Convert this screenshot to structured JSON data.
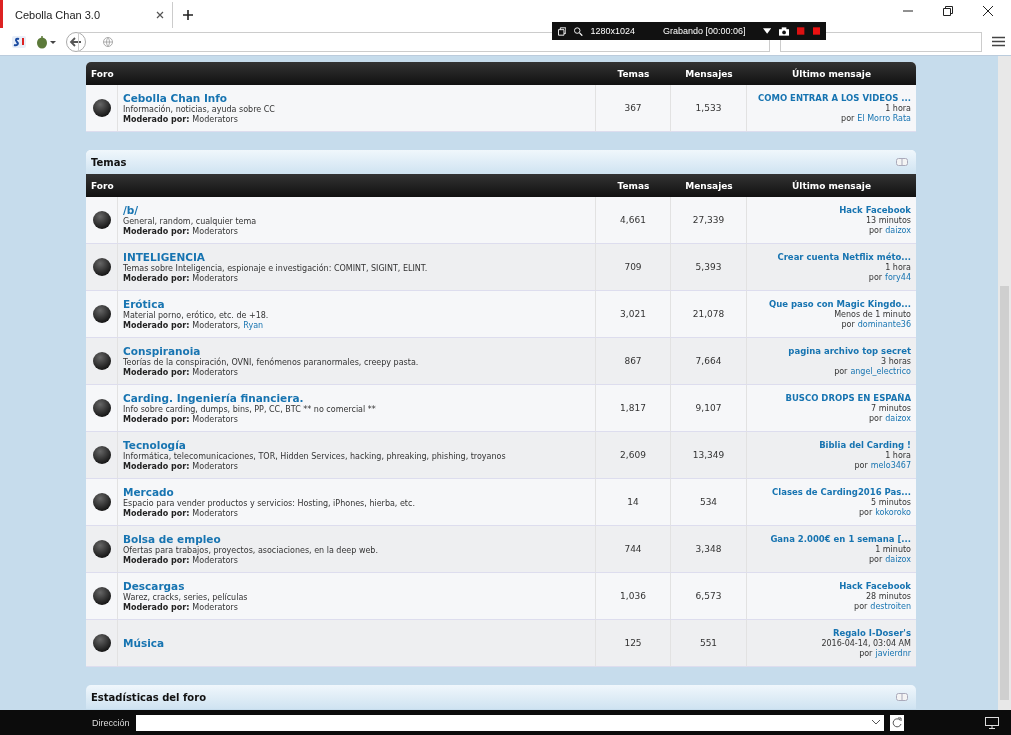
{
  "browser": {
    "tab_title": "Cebolla Chan 3.0",
    "recording": {
      "resolution": "1280x1024",
      "status": "Grabando [00:00:06]"
    }
  },
  "sections": [
    {
      "columns": [
        "Foro",
        "Temas",
        "Mensajes",
        "Último mensaje"
      ],
      "forums": [
        {
          "name": "Cebolla Chan Info",
          "description": "Información, noticias, ayuda sobre CC",
          "moderated_label": "Moderado por:",
          "moderators": [
            {
              "name": "Moderators",
              "kind": "group"
            }
          ],
          "topics": "367",
          "posts": "1,533",
          "last_post": {
            "title": "COMO ENTRAR A LOS VIDEOS ...",
            "time": "1 hora",
            "by": "por",
            "author": "El Morro Rata"
          }
        }
      ]
    },
    {
      "title": "Temas",
      "columns": [
        "Foro",
        "Temas",
        "Mensajes",
        "Último mensaje"
      ],
      "forums": [
        {
          "name": "/b/",
          "description": "General, random, cualquier tema",
          "moderated_label": "Moderado por:",
          "moderators": [
            {
              "name": "Moderators",
              "kind": "group"
            }
          ],
          "topics": "4,661",
          "posts": "27,339",
          "last_post": {
            "title": "Hack Facebook",
            "time": "13 minutos",
            "by": "por",
            "author": "daizox"
          }
        },
        {
          "name": "INTELIGENCIA",
          "description": "Temas sobre Inteligencia, espionaje e investigación: COMINT, SIGINT, ELINT.",
          "moderated_label": "Moderado por:",
          "moderators": [
            {
              "name": "Moderators",
              "kind": "group"
            }
          ],
          "topics": "709",
          "posts": "5,393",
          "last_post": {
            "title": "Crear cuenta Netflix méto...",
            "time": "1 hora",
            "by": "por",
            "author": "fory44"
          }
        },
        {
          "name": "Erótica",
          "description": "Material porno, erótico, etc. de +18.",
          "moderated_label": "Moderado por:",
          "moderators": [
            {
              "name": "Moderators,",
              "kind": "group"
            },
            {
              "name": "Ryan",
              "kind": "user"
            }
          ],
          "topics": "3,021",
          "posts": "21,078",
          "last_post": {
            "title": "Que paso con Magic Kingdo...",
            "time": "Menos de 1 minuto",
            "by": "por",
            "author": "dominante36"
          }
        },
        {
          "name": "Conspiranoia",
          "description": "Teorías de la conspiración, OVNI, fenómenos paranormales, creepy pasta.",
          "moderated_label": "Moderado por:",
          "moderators": [
            {
              "name": "Moderators",
              "kind": "group"
            }
          ],
          "topics": "867",
          "posts": "7,664",
          "last_post": {
            "title": "pagina archivo top secret",
            "time": "3 horas",
            "by": "por",
            "author": "angel_electrico"
          }
        },
        {
          "name": "Carding. Ingeniería financiera.",
          "description": "Info sobre carding, dumps, bins, PP, CC, BTC ** no comercial **",
          "moderated_label": "Moderado por:",
          "moderators": [
            {
              "name": "Moderators",
              "kind": "group"
            }
          ],
          "topics": "1,817",
          "posts": "9,107",
          "last_post": {
            "title": "BUSCO DROPS EN ESPAÑA",
            "time": "7 minutos",
            "by": "por",
            "author": "daizox"
          }
        },
        {
          "name": "Tecnología",
          "description": "Informática, telecomunicaciones, TOR, Hidden Services, hacking, phreaking, phishing, troyanos",
          "moderated_label": "Moderado por:",
          "moderators": [
            {
              "name": "Moderators",
              "kind": "group"
            }
          ],
          "topics": "2,609",
          "posts": "13,349",
          "last_post": {
            "title": "Biblia del Carding !",
            "time": "1 hora",
            "by": "por",
            "author": "melo3467"
          }
        },
        {
          "name": "Mercado",
          "description": "Espacio para vender productos y servicios: Hosting, iPhones, hierba, etc.",
          "moderated_label": "Moderado por:",
          "moderators": [
            {
              "name": "Moderators",
              "kind": "group"
            }
          ],
          "topics": "14",
          "posts": "534",
          "last_post": {
            "title": "Clases de Carding2016 Pas...",
            "time": "5 minutos",
            "by": "por",
            "author": "kokoroko"
          }
        },
        {
          "name": "Bolsa de empleo",
          "description": "Ofertas para trabajos, proyectos, asociaciones, en la deep web.",
          "moderated_label": "Moderado por:",
          "moderators": [
            {
              "name": "Moderators",
              "kind": "group"
            }
          ],
          "topics": "744",
          "posts": "3,348",
          "last_post": {
            "title": "Gana 2.000€ en 1 semana [...",
            "time": "1 minuto",
            "by": "por",
            "author": "daizox"
          }
        },
        {
          "name": "Descargas",
          "description": "Warez, cracks, series, películas",
          "moderated_label": "Moderado por:",
          "moderators": [
            {
              "name": "Moderators",
              "kind": "group"
            }
          ],
          "topics": "1,036",
          "posts": "6,573",
          "last_post": {
            "title": "Hack Facebook",
            "time": "28 minutos",
            "by": "por",
            "author": "destroiten"
          }
        },
        {
          "name": "Música",
          "topics": "125",
          "posts": "551",
          "last_post": {
            "title": "Regalo I-Doser's",
            "time": "2016-04-14, 03:04 AM",
            "by": "por",
            "author": "javierdnr"
          }
        }
      ]
    },
    {
      "title": "Estadísticas del foro"
    }
  ],
  "bottom_bar": {
    "address_label": "Dirección"
  }
}
